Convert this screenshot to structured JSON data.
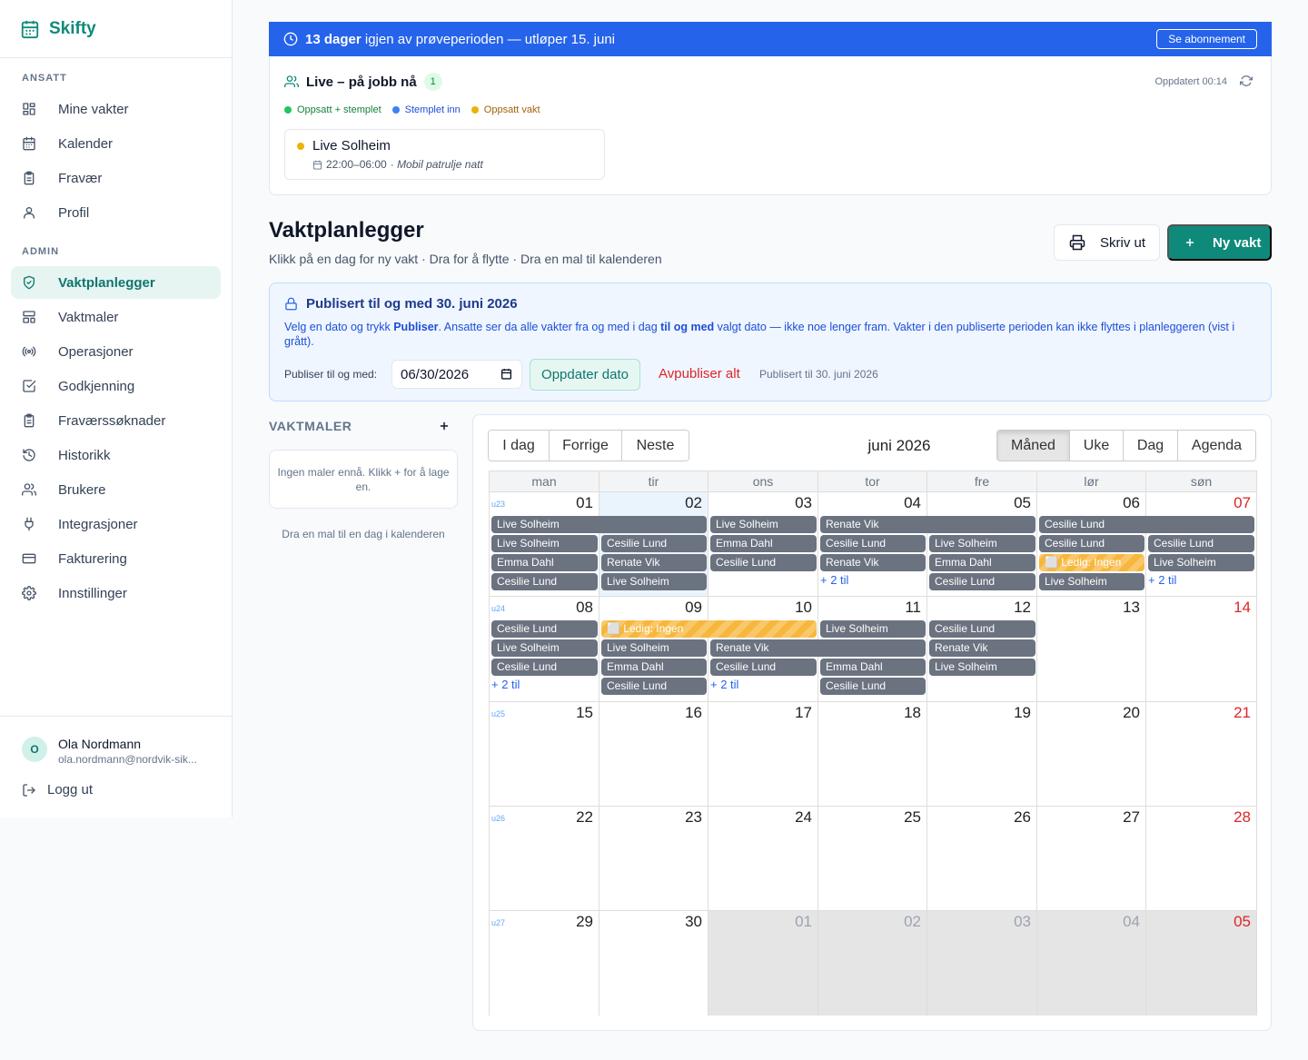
{
  "app": {
    "name": "Skifty"
  },
  "sidebar": {
    "sections": [
      {
        "label": "ANSATT",
        "items": [
          {
            "icon": "dashboard-icon",
            "label": "Mine vakter"
          },
          {
            "icon": "calendar-icon",
            "label": "Kalender"
          },
          {
            "icon": "clipboard-icon",
            "label": "Fravær"
          },
          {
            "icon": "user-icon",
            "label": "Profil"
          }
        ]
      },
      {
        "label": "ADMIN",
        "items": [
          {
            "icon": "shield-icon",
            "label": "Vaktplanlegger",
            "active": true
          },
          {
            "icon": "layout-icon",
            "label": "Vaktmaler"
          },
          {
            "icon": "radio-icon",
            "label": "Operasjoner"
          },
          {
            "icon": "check-square-icon",
            "label": "Godkjenning"
          },
          {
            "icon": "clipboard-icon",
            "label": "Fraværssøknader"
          },
          {
            "icon": "history-icon",
            "label": "Historikk"
          },
          {
            "icon": "users-icon",
            "label": "Brukere"
          },
          {
            "icon": "plug-icon",
            "label": "Integrasjoner"
          },
          {
            "icon": "credit-card-icon",
            "label": "Fakturering"
          },
          {
            "icon": "gear-icon",
            "label": "Innstillinger"
          }
        ]
      }
    ],
    "user": {
      "initial": "O",
      "name": "Ola Nordmann",
      "email": "ola.nordmann@nordvik-sik..."
    },
    "logout": "Logg ut"
  },
  "trial_banner": {
    "bold": "13 dager",
    "text": " igjen av prøveperioden — utløper 15. juni",
    "button": "Se abonnement"
  },
  "live": {
    "title": "Live – på jobb nå",
    "count": "1",
    "updated": "Oppdatert 00:14",
    "legend": [
      {
        "label": "Oppsatt + stemplet",
        "color": "#22c55e",
        "text_color": "#15803d"
      },
      {
        "label": "Stemplet inn",
        "color": "#3b82f6",
        "text_color": "#1d4ed8"
      },
      {
        "label": "Oppsatt vakt",
        "color": "#eab308",
        "text_color": "#a16207"
      }
    ],
    "person": {
      "name": "Live Solheim",
      "time": "22:00–06:00",
      "detail": "· Mobil patrulje natt",
      "status_color": "#eab308"
    }
  },
  "page": {
    "title": "Vaktplanlegger",
    "subtitle": "Klikk på en dag for ny vakt · Dra for å flytte · Dra en mal til kalenderen",
    "print_button": "Skriv ut",
    "new_button": "Ny vakt"
  },
  "publish": {
    "title_prefix": "Publisert til og med ",
    "title_date": "30. juni 2026",
    "desc_1": "Velg en dato og trykk ",
    "desc_bold_1": "Publiser",
    "desc_2": ". Ansatte ser da alle vakter fra og med i dag ",
    "desc_bold_2": "til og med",
    "desc_3": " valgt dato — ikke noe lenger fram. Vakter i den publiserte perioden kan ikke flyttes i planleggeren (vist i grått).",
    "input_label": "Publiser til og med:",
    "input_value": "06/30/2026",
    "update_button": "Oppdater dato",
    "unpublish_button": "Avpubliser alt",
    "status": "Publisert til 30. juni 2026"
  },
  "templates": {
    "title": "VAKTMALER",
    "empty": "Ingen maler ennå. Klikk + for å lage en.",
    "hint": "Dra en mal til en dag i kalenderen"
  },
  "calendar": {
    "nav": [
      "I dag",
      "Forrige",
      "Neste"
    ],
    "title": "juni 2026",
    "views": [
      "Måned",
      "Uke",
      "Dag",
      "Agenda"
    ],
    "active_view": "Måned",
    "weekdays": [
      "man",
      "tir",
      "ons",
      "tor",
      "fre",
      "lør",
      "søn"
    ],
    "weeks": [
      {
        "label": "u23",
        "days": [
          "01",
          "02",
          "03",
          "04",
          "05",
          "06",
          "07"
        ]
      },
      {
        "label": "u24",
        "days": [
          "08",
          "09",
          "10",
          "11",
          "12",
          "13",
          "14"
        ]
      },
      {
        "label": "u25",
        "days": [
          "15",
          "16",
          "17",
          "18",
          "19",
          "20",
          "21"
        ]
      },
      {
        "label": "u26",
        "days": [
          "22",
          "23",
          "24",
          "25",
          "26",
          "27",
          "28"
        ]
      },
      {
        "label": "u27",
        "days": [
          "29",
          "30",
          "01",
          "02",
          "03",
          "04",
          "05"
        ]
      }
    ],
    "today": {
      "week": 0,
      "day": 1
    },
    "off_cells": [
      [
        4,
        2
      ],
      [
        4,
        3
      ],
      [
        4,
        4
      ],
      [
        4,
        5
      ],
      [
        4,
        6
      ]
    ],
    "events": [
      {
        "w": 0,
        "d": 0,
        "span": 2,
        "row": 0,
        "label": "Live Solheim"
      },
      {
        "w": 0,
        "d": 2,
        "span": 1,
        "row": 0,
        "label": "Live Solheim"
      },
      {
        "w": 0,
        "d": 3,
        "span": 2,
        "row": 0,
        "label": "Renate Vik"
      },
      {
        "w": 0,
        "d": 5,
        "span": 2,
        "row": 0,
        "label": "Cesilie Lund"
      },
      {
        "w": 0,
        "d": 0,
        "span": 1,
        "row": 1,
        "label": "Live Solheim"
      },
      {
        "w": 0,
        "d": 1,
        "span": 1,
        "row": 1,
        "label": "Cesilie Lund"
      },
      {
        "w": 0,
        "d": 2,
        "span": 1,
        "row": 1,
        "label": "Emma Dahl"
      },
      {
        "w": 0,
        "d": 3,
        "span": 1,
        "row": 1,
        "label": "Cesilie Lund"
      },
      {
        "w": 0,
        "d": 4,
        "span": 1,
        "row": 1,
        "label": "Live Solheim"
      },
      {
        "w": 0,
        "d": 5,
        "span": 1,
        "row": 1,
        "label": "Cesilie Lund"
      },
      {
        "w": 0,
        "d": 6,
        "span": 1,
        "row": 1,
        "label": "Cesilie Lund"
      },
      {
        "w": 0,
        "d": 0,
        "span": 1,
        "row": 2,
        "label": "Emma Dahl"
      },
      {
        "w": 0,
        "d": 1,
        "span": 1,
        "row": 2,
        "label": "Renate Vik"
      },
      {
        "w": 0,
        "d": 2,
        "span": 1,
        "row": 2,
        "label": "Cesilie Lund"
      },
      {
        "w": 0,
        "d": 3,
        "span": 1,
        "row": 2,
        "label": "Renate Vik"
      },
      {
        "w": 0,
        "d": 4,
        "span": 1,
        "row": 2,
        "label": "Emma Dahl"
      },
      {
        "w": 0,
        "d": 5,
        "span": 1,
        "row": 2,
        "label": "⬜ Ledig: Ingen",
        "open": true
      },
      {
        "w": 0,
        "d": 6,
        "span": 1,
        "row": 2,
        "label": "Live Solheim"
      },
      {
        "w": 0,
        "d": 0,
        "span": 1,
        "row": 3,
        "label": "Cesilie Lund"
      },
      {
        "w": 0,
        "d": 1,
        "span": 1,
        "row": 3,
        "label": "Live Solheim"
      },
      {
        "w": 0,
        "d": 4,
        "span": 1,
        "row": 3,
        "label": "Cesilie Lund"
      },
      {
        "w": 0,
        "d": 5,
        "span": 1,
        "row": 3,
        "label": "Live Solheim"
      },
      {
        "w": 1,
        "d": 0,
        "span": 1,
        "row": 0,
        "label": "Cesilie Lund"
      },
      {
        "w": 1,
        "d": 1,
        "span": 2,
        "row": 0,
        "label": "⬜ Ledig: Ingen",
        "open": true
      },
      {
        "w": 1,
        "d": 3,
        "span": 1,
        "row": 0,
        "label": "Live Solheim"
      },
      {
        "w": 1,
        "d": 4,
        "span": 1,
        "row": 0,
        "label": "Cesilie Lund"
      },
      {
        "w": 1,
        "d": 0,
        "span": 1,
        "row": 1,
        "label": "Live Solheim"
      },
      {
        "w": 1,
        "d": 1,
        "span": 1,
        "row": 1,
        "label": "Live Solheim"
      },
      {
        "w": 1,
        "d": 2,
        "span": 2,
        "row": 1,
        "label": "Renate Vik"
      },
      {
        "w": 1,
        "d": 4,
        "span": 1,
        "row": 1,
        "label": "Renate Vik"
      },
      {
        "w": 1,
        "d": 0,
        "span": 1,
        "row": 2,
        "label": "Cesilie Lund"
      },
      {
        "w": 1,
        "d": 1,
        "span": 1,
        "row": 2,
        "label": "Emma Dahl"
      },
      {
        "w": 1,
        "d": 2,
        "span": 1,
        "row": 2,
        "label": "Cesilie Lund"
      },
      {
        "w": 1,
        "d": 3,
        "span": 1,
        "row": 2,
        "label": "Emma Dahl"
      },
      {
        "w": 1,
        "d": 4,
        "span": 1,
        "row": 2,
        "label": "Live Solheim"
      },
      {
        "w": 1,
        "d": 1,
        "span": 1,
        "row": 3,
        "label": "Cesilie Lund"
      },
      {
        "w": 1,
        "d": 3,
        "span": 1,
        "row": 3,
        "label": "Cesilie Lund"
      }
    ],
    "more": [
      {
        "w": 0,
        "d": 3,
        "row": 3,
        "label": "+ 2 til"
      },
      {
        "w": 0,
        "d": 6,
        "row": 3,
        "label": "+ 2 til"
      },
      {
        "w": 1,
        "d": 0,
        "row": 3,
        "label": "+ 2 til"
      },
      {
        "w": 1,
        "d": 2,
        "row": 3,
        "label": "+ 2 til"
      }
    ]
  }
}
